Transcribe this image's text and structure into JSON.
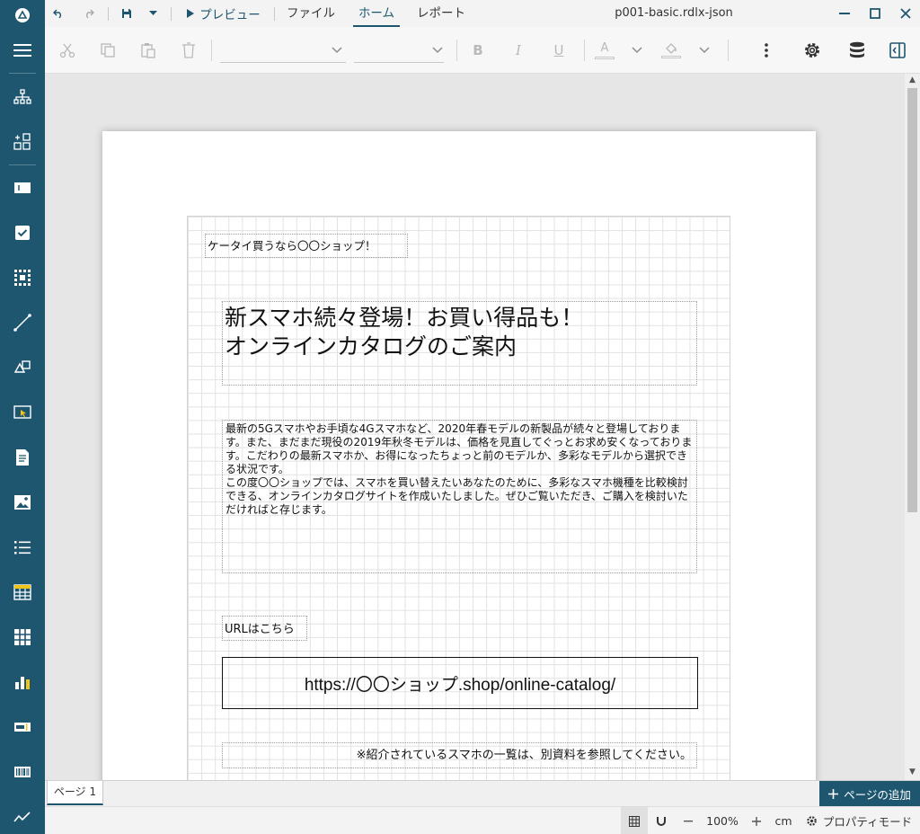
{
  "titlebar": {
    "preview_label": "プレビュー",
    "tabs": [
      {
        "label": "ファイル",
        "active": false
      },
      {
        "label": "ホーム",
        "active": true
      },
      {
        "label": "レポート",
        "active": false
      }
    ],
    "document_title": "p001-basic.rdlx-json"
  },
  "ribbon": {
    "font_buttons": {
      "bold": "B",
      "italic": "I",
      "underline": "U",
      "font_color": "A"
    }
  },
  "report": {
    "header_text": "ケータイ買うなら〇〇ショップ！",
    "title_line1": "新スマホ続々登場！お買い得品も！",
    "title_line2": "オンラインカタログのご案内",
    "body_text": "最新の5Gスマホやお手頃な4Gスマホなど、2020年春モデルの新製品が続々と登場しております。また、まだまだ現役の2019年秋冬モデルは、価格を見直してぐっとお求め安くなっております。こだわりの最新スマホか、お得になったちょっと前のモデルか、多彩なモデルから選択できる状況です。\nこの度〇〇ショップでは、スマホを買い替えたいあなたのために、多彩なスマホ機種を比較検討できる、オンラインカタログサイトを作成いたしました。ぜひご覧いただき、ご購入を検討いただければと存じます。",
    "url_label": "URLはこちら",
    "url": "https://〇〇ショップ.shop/online-catalog/",
    "footnote": "※紹介されているスマホの一覧は、別資料を参照してください。"
  },
  "pagebar": {
    "page_tab": "ページ 1",
    "add_page_label": "ページの追加"
  },
  "statusbar": {
    "zoom": "100%",
    "unit": "cm",
    "property_mode": "プロパティモード"
  },
  "colors": {
    "sidebar": "#1e5670",
    "accent": "#1e5670"
  }
}
